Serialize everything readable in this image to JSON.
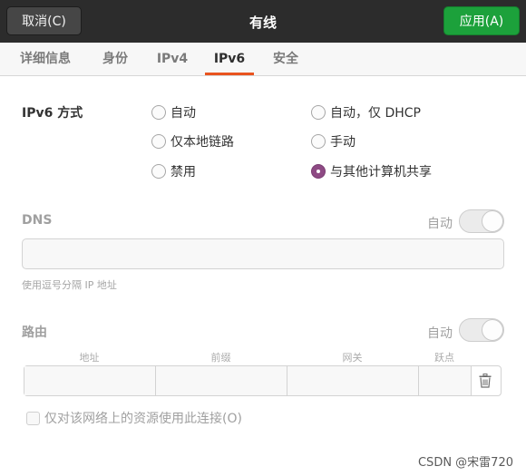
{
  "header": {
    "cancel_label": "取消(C)",
    "title": "有线",
    "apply_label": "应用(A)",
    "apply_color": "#1ca13b"
  },
  "tabs": [
    {
      "label": "详细信息",
      "active": false
    },
    {
      "label": "身份",
      "active": false
    },
    {
      "label": "IPv4",
      "active": false
    },
    {
      "label": "IPv6",
      "active": true
    },
    {
      "label": "安全",
      "active": false
    }
  ],
  "ipv6_method": {
    "label": "IPv6 方式",
    "options": [
      {
        "label": "自动",
        "selected": false
      },
      {
        "label": "自动，仅 DHCP",
        "selected": false
      },
      {
        "label": "仅本地链路",
        "selected": false
      },
      {
        "label": "手动",
        "selected": false
      },
      {
        "label": "禁用",
        "selected": false
      },
      {
        "label": "与其他计算机共享",
        "selected": true
      }
    ],
    "selected_color": "#8e4a84"
  },
  "dns": {
    "label": "DNS",
    "auto_label": "自动",
    "auto_enabled": false,
    "input_value": "",
    "hint": "使用逗号分隔 IP 地址"
  },
  "routes": {
    "label": "路由",
    "auto_label": "自动",
    "auto_enabled": false,
    "columns": [
      "地址",
      "前缀",
      "网关",
      "跃点"
    ],
    "row": {
      "address": "",
      "prefix": "",
      "gateway": "",
      "metric": ""
    },
    "delete_icon": "trash-icon"
  },
  "only_local_checkbox": {
    "label": "仅对该网络上的资源使用此连接(O)",
    "checked": false
  },
  "watermark": "CSDN @宋雷720",
  "accent_color": "#e95420"
}
